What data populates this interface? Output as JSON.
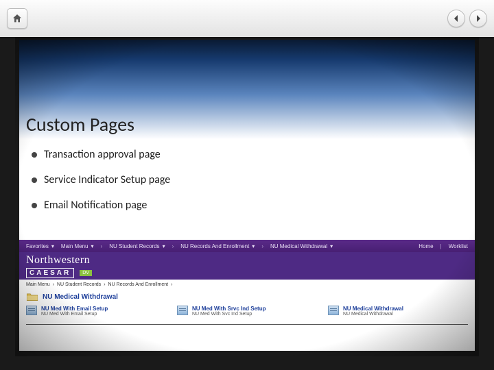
{
  "viewer": {
    "home_label": "home",
    "prev_label": "previous-slide",
    "next_label": "next-slide"
  },
  "slide": {
    "title": "Custom Pages",
    "bullets": [
      "Transaction approval page",
      "Service Indicator Setup page",
      "Email Notification page"
    ]
  },
  "app": {
    "nav_items": [
      "Favorites",
      "Main Menu",
      "NU Student Records",
      "NU Records And Enrollment",
      "NU Medical Withdrawal"
    ],
    "nav_right": [
      "Home",
      "Worklist"
    ],
    "brand": "Northwestern",
    "brand_sub": "CAESAR",
    "brand_env": "DV",
    "breadcrumbs": [
      "Main Menu",
      "NU Student Records",
      "NU Records And Enrollment"
    ],
    "folder_link": "NU Medical Withdrawal",
    "entries": [
      {
        "title": "NU Med With Email Setup",
        "sub": "NU Med With Email Setup"
      },
      {
        "title": "NU Med With Srvc Ind Setup",
        "sub": "NU Med With Svc Ind Setup"
      },
      {
        "title": "NU Medical Withdrawal",
        "sub": "NU Medical Withdrawal"
      }
    ]
  }
}
